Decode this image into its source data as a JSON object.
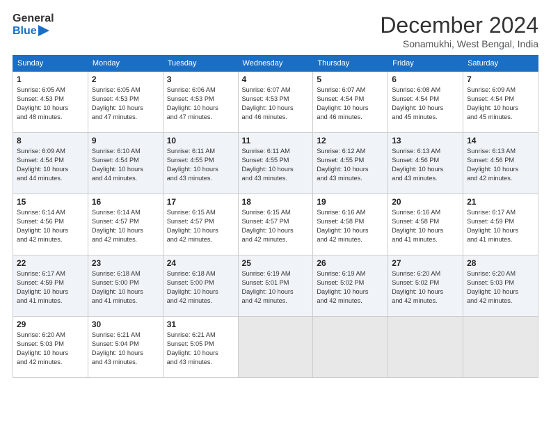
{
  "header": {
    "logo_line1": "General",
    "logo_line2": "Blue",
    "month_title": "December 2024",
    "location": "Sonamukhi, West Bengal, India"
  },
  "weekdays": [
    "Sunday",
    "Monday",
    "Tuesday",
    "Wednesday",
    "Thursday",
    "Friday",
    "Saturday"
  ],
  "weeks": [
    [
      {
        "day": "1",
        "info": "Sunrise: 6:05 AM\nSunset: 4:53 PM\nDaylight: 10 hours\nand 48 minutes."
      },
      {
        "day": "2",
        "info": "Sunrise: 6:05 AM\nSunset: 4:53 PM\nDaylight: 10 hours\nand 47 minutes."
      },
      {
        "day": "3",
        "info": "Sunrise: 6:06 AM\nSunset: 4:53 PM\nDaylight: 10 hours\nand 47 minutes."
      },
      {
        "day": "4",
        "info": "Sunrise: 6:07 AM\nSunset: 4:53 PM\nDaylight: 10 hours\nand 46 minutes."
      },
      {
        "day": "5",
        "info": "Sunrise: 6:07 AM\nSunset: 4:54 PM\nDaylight: 10 hours\nand 46 minutes."
      },
      {
        "day": "6",
        "info": "Sunrise: 6:08 AM\nSunset: 4:54 PM\nDaylight: 10 hours\nand 45 minutes."
      },
      {
        "day": "7",
        "info": "Sunrise: 6:09 AM\nSunset: 4:54 PM\nDaylight: 10 hours\nand 45 minutes."
      }
    ],
    [
      {
        "day": "8",
        "info": "Sunrise: 6:09 AM\nSunset: 4:54 PM\nDaylight: 10 hours\nand 44 minutes."
      },
      {
        "day": "9",
        "info": "Sunrise: 6:10 AM\nSunset: 4:54 PM\nDaylight: 10 hours\nand 44 minutes."
      },
      {
        "day": "10",
        "info": "Sunrise: 6:11 AM\nSunset: 4:55 PM\nDaylight: 10 hours\nand 43 minutes."
      },
      {
        "day": "11",
        "info": "Sunrise: 6:11 AM\nSunset: 4:55 PM\nDaylight: 10 hours\nand 43 minutes."
      },
      {
        "day": "12",
        "info": "Sunrise: 6:12 AM\nSunset: 4:55 PM\nDaylight: 10 hours\nand 43 minutes."
      },
      {
        "day": "13",
        "info": "Sunrise: 6:13 AM\nSunset: 4:56 PM\nDaylight: 10 hours\nand 43 minutes."
      },
      {
        "day": "14",
        "info": "Sunrise: 6:13 AM\nSunset: 4:56 PM\nDaylight: 10 hours\nand 42 minutes."
      }
    ],
    [
      {
        "day": "15",
        "info": "Sunrise: 6:14 AM\nSunset: 4:56 PM\nDaylight: 10 hours\nand 42 minutes."
      },
      {
        "day": "16",
        "info": "Sunrise: 6:14 AM\nSunset: 4:57 PM\nDaylight: 10 hours\nand 42 minutes."
      },
      {
        "day": "17",
        "info": "Sunrise: 6:15 AM\nSunset: 4:57 PM\nDaylight: 10 hours\nand 42 minutes."
      },
      {
        "day": "18",
        "info": "Sunrise: 6:15 AM\nSunset: 4:57 PM\nDaylight: 10 hours\nand 42 minutes."
      },
      {
        "day": "19",
        "info": "Sunrise: 6:16 AM\nSunset: 4:58 PM\nDaylight: 10 hours\nand 42 minutes."
      },
      {
        "day": "20",
        "info": "Sunrise: 6:16 AM\nSunset: 4:58 PM\nDaylight: 10 hours\nand 41 minutes."
      },
      {
        "day": "21",
        "info": "Sunrise: 6:17 AM\nSunset: 4:59 PM\nDaylight: 10 hours\nand 41 minutes."
      }
    ],
    [
      {
        "day": "22",
        "info": "Sunrise: 6:17 AM\nSunset: 4:59 PM\nDaylight: 10 hours\nand 41 minutes."
      },
      {
        "day": "23",
        "info": "Sunrise: 6:18 AM\nSunset: 5:00 PM\nDaylight: 10 hours\nand 41 minutes."
      },
      {
        "day": "24",
        "info": "Sunrise: 6:18 AM\nSunset: 5:00 PM\nDaylight: 10 hours\nand 42 minutes."
      },
      {
        "day": "25",
        "info": "Sunrise: 6:19 AM\nSunset: 5:01 PM\nDaylight: 10 hours\nand 42 minutes."
      },
      {
        "day": "26",
        "info": "Sunrise: 6:19 AM\nSunset: 5:02 PM\nDaylight: 10 hours\nand 42 minutes."
      },
      {
        "day": "27",
        "info": "Sunrise: 6:20 AM\nSunset: 5:02 PM\nDaylight: 10 hours\nand 42 minutes."
      },
      {
        "day": "28",
        "info": "Sunrise: 6:20 AM\nSunset: 5:03 PM\nDaylight: 10 hours\nand 42 minutes."
      }
    ],
    [
      {
        "day": "29",
        "info": "Sunrise: 6:20 AM\nSunset: 5:03 PM\nDaylight: 10 hours\nand 42 minutes."
      },
      {
        "day": "30",
        "info": "Sunrise: 6:21 AM\nSunset: 5:04 PM\nDaylight: 10 hours\nand 43 minutes."
      },
      {
        "day": "31",
        "info": "Sunrise: 6:21 AM\nSunset: 5:05 PM\nDaylight: 10 hours\nand 43 minutes."
      },
      {
        "day": "",
        "info": ""
      },
      {
        "day": "",
        "info": ""
      },
      {
        "day": "",
        "info": ""
      },
      {
        "day": "",
        "info": ""
      }
    ]
  ]
}
